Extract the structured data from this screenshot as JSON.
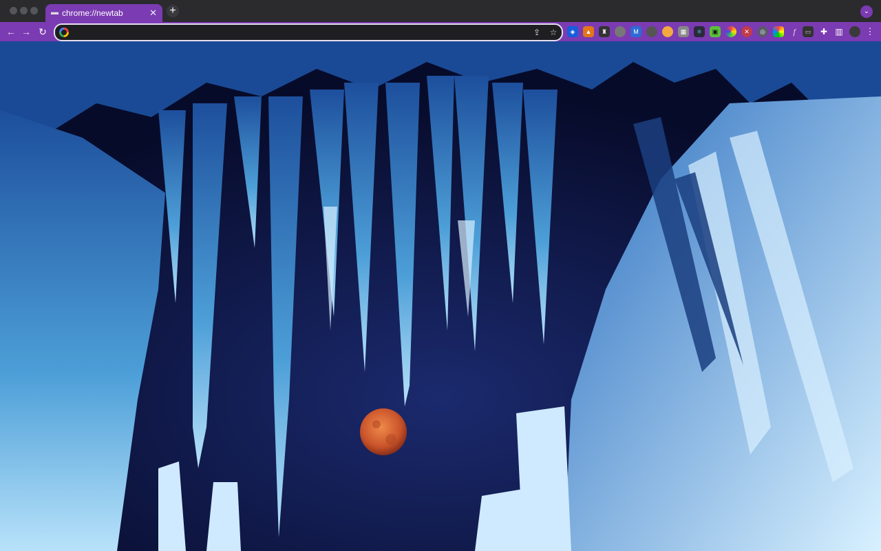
{
  "tab": {
    "title": "chrome://newtab",
    "favicon": "camera-icon"
  },
  "omnibox": {
    "value": "",
    "placeholder": ""
  },
  "colors": {
    "tab_accent": "#7b3bb2",
    "titlebar": "#2b2b2e",
    "sky": "#0e1a44",
    "ice": "#4d9fd8",
    "moon": "#c9532a"
  },
  "extensions": [
    "bitwarden-icon",
    "metamask-icon",
    "ghost-icon",
    "puzzle-gray-icon",
    "m-extension-icon",
    "circle-gray-icon",
    "honey-icon",
    "screenshot-icon",
    "react-icon",
    "ublock-icon",
    "color-picker-icon",
    "red-extension-icon",
    "compass-icon",
    "chromatic-icon",
    "font-icon",
    "camera-icon",
    "extensions-puzzle-icon",
    "sidepanel-icon",
    "avatar-icon",
    "kebab-menu-icon"
  ]
}
